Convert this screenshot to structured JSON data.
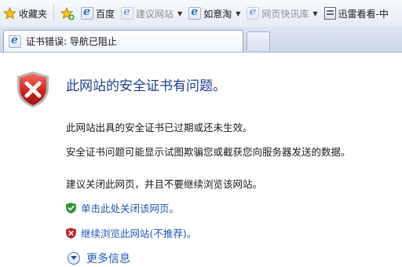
{
  "favorites_bar": {
    "items": [
      {
        "label": "收藏夹",
        "icon": "star-icon"
      },
      {
        "label": "百度",
        "icon": "ie-page-icon"
      },
      {
        "label": "建议网站",
        "icon": "ie-page-icon",
        "dim": true,
        "dropdown": true
      },
      {
        "label": "如意淘",
        "icon": "ie-page-icon",
        "dropdown": true
      },
      {
        "label": "网页快讯库",
        "icon": "ie-page-icon",
        "dim": true,
        "dropdown": true
      },
      {
        "label": "迅雷看看-中",
        "icon": "page-icon"
      }
    ]
  },
  "tab": {
    "title": "证书错误: 导航已阻止",
    "icon": "ie-page-icon"
  },
  "main": {
    "title": "此网站的安全证书有问题。",
    "paragraphs": [
      "此网站出具的安全证书已过期或还未生效。",
      "安全证书问题可能显示试图欺骗您或截获您向服务器发送的数据。",
      "建议关闭此网页，并且不要继续浏览该网站。"
    ],
    "options": [
      {
        "label": "单击此处关闭该网页。",
        "icon": "green-shield-check-icon"
      },
      {
        "label": "继续浏览此网站(不推荐)。",
        "icon": "red-shield-x-icon"
      }
    ],
    "more_info": "更多信息"
  },
  "colors": {
    "title": "#1f3f8f",
    "link": "#1d59b8",
    "shield_red": "#c92020",
    "shield_green": "#2e9b32"
  }
}
